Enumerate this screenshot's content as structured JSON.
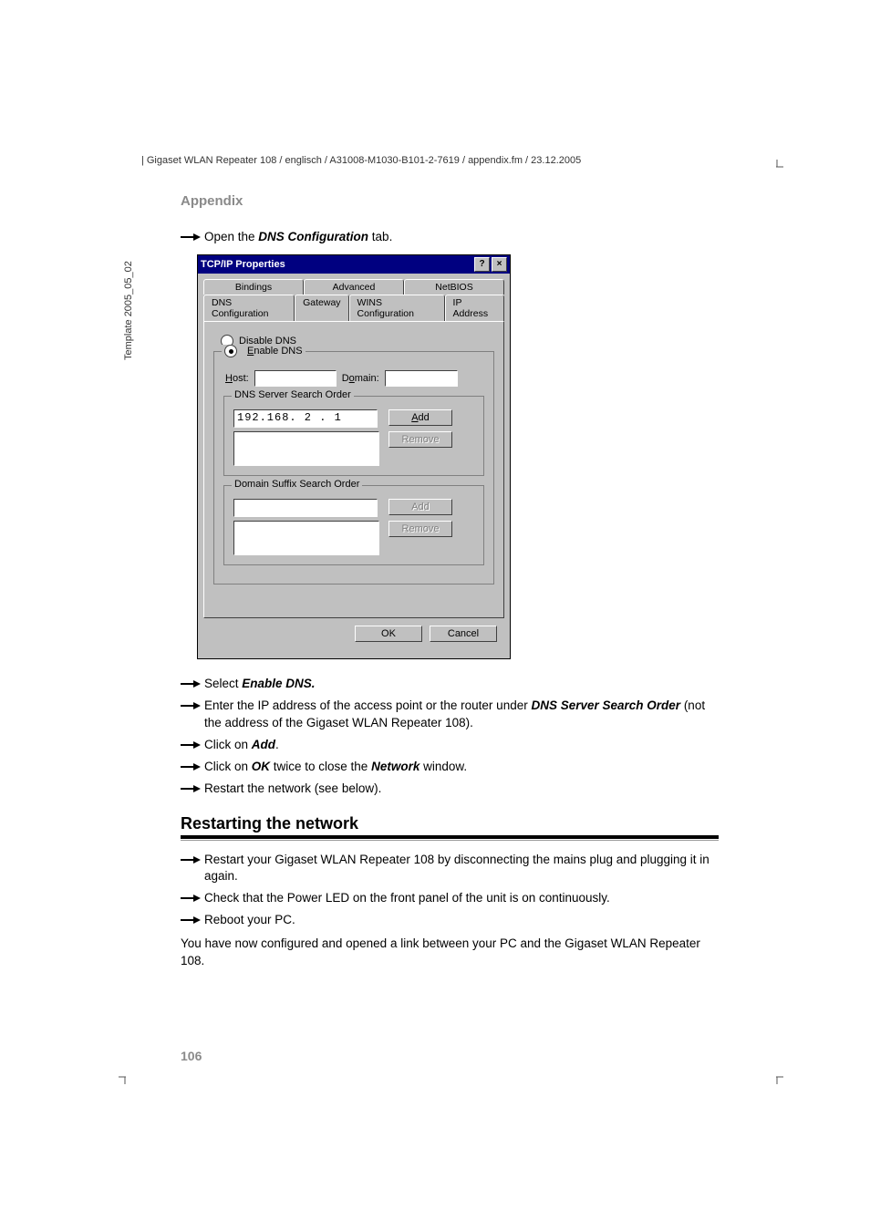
{
  "header": {
    "path": "Gigaset WLAN Repeater 108 / englisch / A31008-M1030-B101-2-7619 / appendix.fm / 23.12.2005"
  },
  "sidebar": {
    "template_label": "Template 2005_05_02"
  },
  "section": {
    "label": "Appendix"
  },
  "steps_top": {
    "s1_pre": "Open the ",
    "s1_bi": "DNS Configuration",
    "s1_post": " tab."
  },
  "dialog": {
    "title": "TCP/IP Properties",
    "help_btn": "?",
    "close_btn": "×",
    "tabs_back": [
      "Bindings",
      "Advanced",
      "NetBIOS"
    ],
    "tabs_front": [
      "DNS Configuration",
      "Gateway",
      "WINS Configuration",
      "IP Address"
    ],
    "radio_disable": "Disable DNS",
    "radio_enable": "Enable DNS",
    "host_label": "Host:",
    "domain_label": "Domain:",
    "group1_legend": "DNS Server Search Order",
    "ip_value": "192.168.  2 .  1",
    "add_btn": "Add",
    "remove_btn": "Remove",
    "group2_legend": "Domain Suffix Search Order",
    "ok_btn": "OK",
    "cancel_btn": "Cancel"
  },
  "steps_mid": {
    "s2_pre": "Select ",
    "s2_bi": "Enable DNS.",
    "s3_pre": "Enter the IP address of the access point or the router under ",
    "s3_bi": "DNS Server Search Order",
    "s3_post": " (not the address of the Gigaset WLAN Repeater 108).",
    "s4_pre": "Click on ",
    "s4_bi": "Add",
    "s4_post": ".",
    "s5_pre": "Click on ",
    "s5_bi1": "OK",
    "s5_mid": " twice to close the ",
    "s5_bi2": "Network",
    "s5_post": " window.",
    "s6": "Restart the network (see below)."
  },
  "heading2": "Restarting the network",
  "steps_bot": {
    "s7": "Restart your Gigaset WLAN Repeater 108 by disconnecting the mains plug and plugging it in again.",
    "s8": "Check that the Power LED on the front panel of the unit is on continuously.",
    "s9": "Reboot your PC."
  },
  "closing": "You have now configured and opened a link between your PC and the Gigaset WLAN Repeater 108.",
  "page_number": "106"
}
